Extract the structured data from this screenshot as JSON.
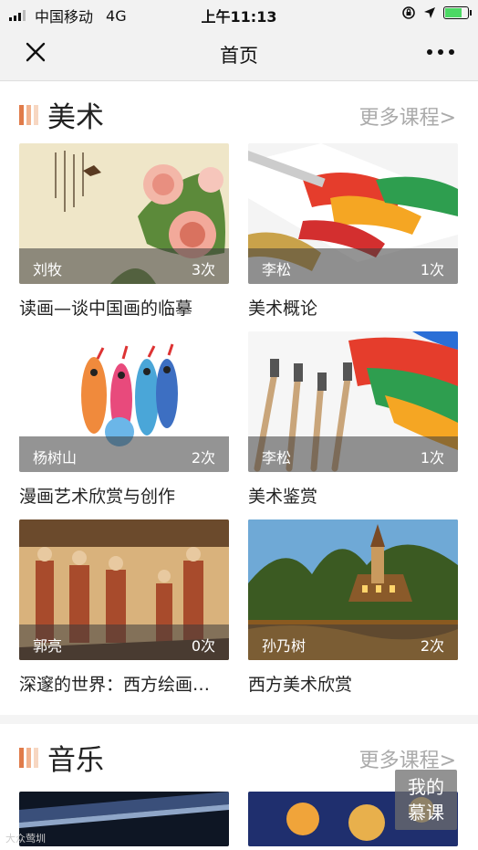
{
  "status": {
    "carrier": "中国移动",
    "network": "4G",
    "time": "上午11:13"
  },
  "nav": {
    "title": "首页"
  },
  "sections": [
    {
      "name": "美术",
      "more_label": "更多课程>",
      "accent_colors": [
        "#e07b4a",
        "#f2b38f",
        "#f7d7c2"
      ],
      "courses": [
        {
          "title": "读画—谈中国画的临摹",
          "teacher": "刘牧",
          "count": "3次"
        },
        {
          "title": "美术概论",
          "teacher": "李松",
          "count": "1次"
        },
        {
          "title": "漫画艺术欣赏与创作",
          "teacher": "杨树山",
          "count": "2次"
        },
        {
          "title": "美术鉴赏",
          "teacher": "李松",
          "count": "1次"
        },
        {
          "title": "深邃的世界：西方绘画…",
          "teacher": "郭亮",
          "count": "0次"
        },
        {
          "title": "西方美术欣赏",
          "teacher": "孙乃树",
          "count": "2次"
        }
      ]
    },
    {
      "name": "音乐",
      "more_label": "更多课程>"
    }
  ],
  "float_button": {
    "line1": "我的",
    "line2": "慕课"
  },
  "watermark": "大众莺圳",
  "icons": {
    "close": "close-icon",
    "more": "more-dots-icon",
    "location": "location-arrow-icon",
    "lock": "rotation-lock-icon",
    "battery": "battery-icon",
    "signal": "signal-icon"
  }
}
